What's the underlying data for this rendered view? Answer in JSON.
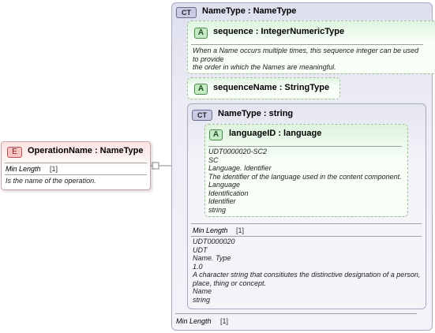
{
  "element": {
    "badge": "E",
    "title": "OperationName : NameType",
    "facet_label": "Min Length",
    "facet_value": "[1]",
    "doc": "Is the name of the operation."
  },
  "complex_type": {
    "badge": "CT",
    "title": "NameType : NameType",
    "sequence_attr": {
      "badge": "A",
      "title": "sequence : IntegerNumericType",
      "doc": "When a Name occurs multiple times, this sequence integer can be used\nto provide\nthe order in which the Names are meaningful."
    },
    "sequence_name_attr": {
      "badge": "A",
      "title": "sequenceName : StringType"
    },
    "inner_type": {
      "badge": "CT",
      "title": "NameType : string",
      "language_attr": {
        "badge": "A",
        "title": "languageID : language",
        "doc": "UDT0000020-SC2\nSC\nLanguage. Identifier\nThe identifier of the language used in the content component.\nLanguage\nIdentification\nIdentifier\nstring"
      },
      "facet_label": "Min Length",
      "facet_value": "[1]",
      "doc": "UDT0000020\nUDT\nName. Type\n1.0\nA character string that consitiutes the distinctive designation of a person,\nplace, thing or concept.\nName\nstring"
    },
    "facet_label": "Min Length",
    "facet_value": "[1]"
  },
  "colors": {
    "element_fill": "#fde2e2",
    "complex_type_fill": "#dedfee",
    "attribute_fill": "#dff3df"
  }
}
